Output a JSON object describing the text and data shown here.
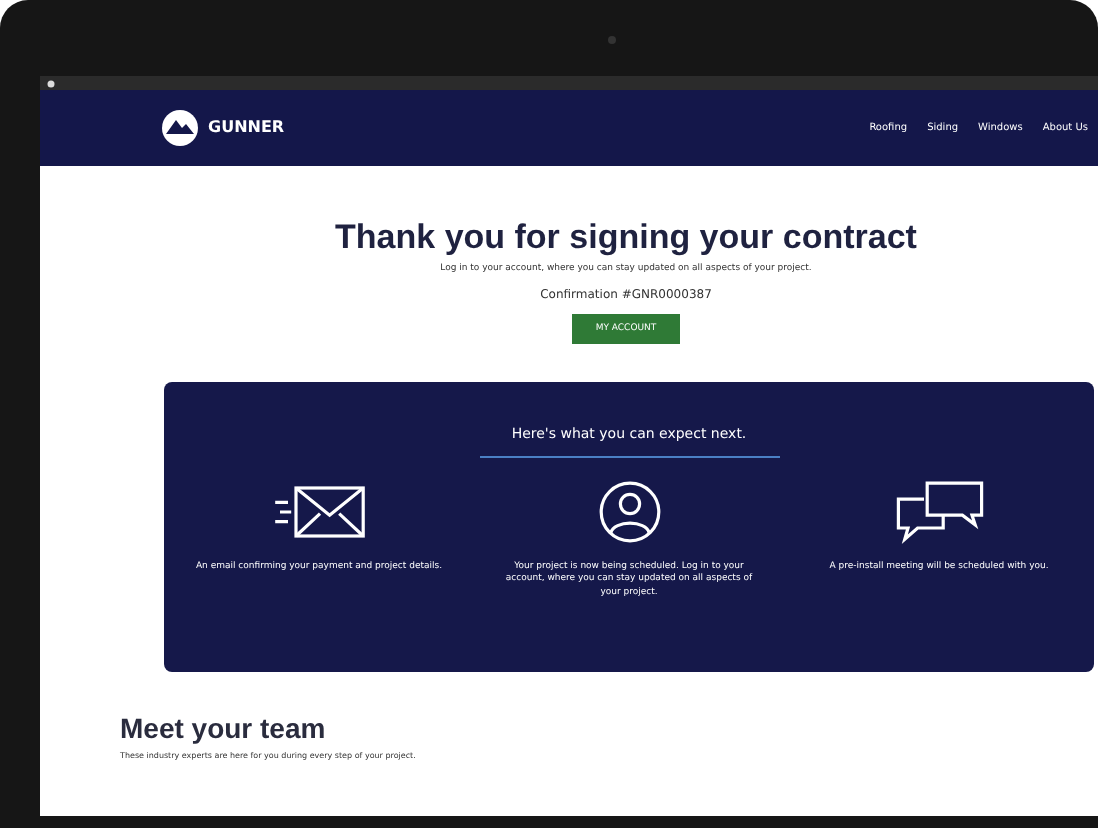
{
  "nav": {
    "brand": "GUNNER",
    "links": [
      "Roofing",
      "Siding",
      "Windows",
      "About Us"
    ]
  },
  "hero": {
    "title": "Thank you for signing your contract",
    "subtitle": "Log in to your account, where you can stay updated on all aspects of your project.",
    "confirmation": "Confirmation #GNR0000387",
    "button": "MY ACCOUNT"
  },
  "next_steps": {
    "title": "Here's what you can expect next.",
    "items": [
      {
        "kind": "email",
        "text": "An email confirming your payment and project details."
      },
      {
        "kind": "account",
        "text": "Your project is now being scheduled. Log in to your account, where you can stay updated on all aspects of your project."
      },
      {
        "kind": "chat",
        "text": "A pre-install meeting will be scheduled with you."
      }
    ]
  },
  "team": {
    "title": "Meet your team",
    "subtitle": "These industry experts are here for you during every step of your project."
  }
}
